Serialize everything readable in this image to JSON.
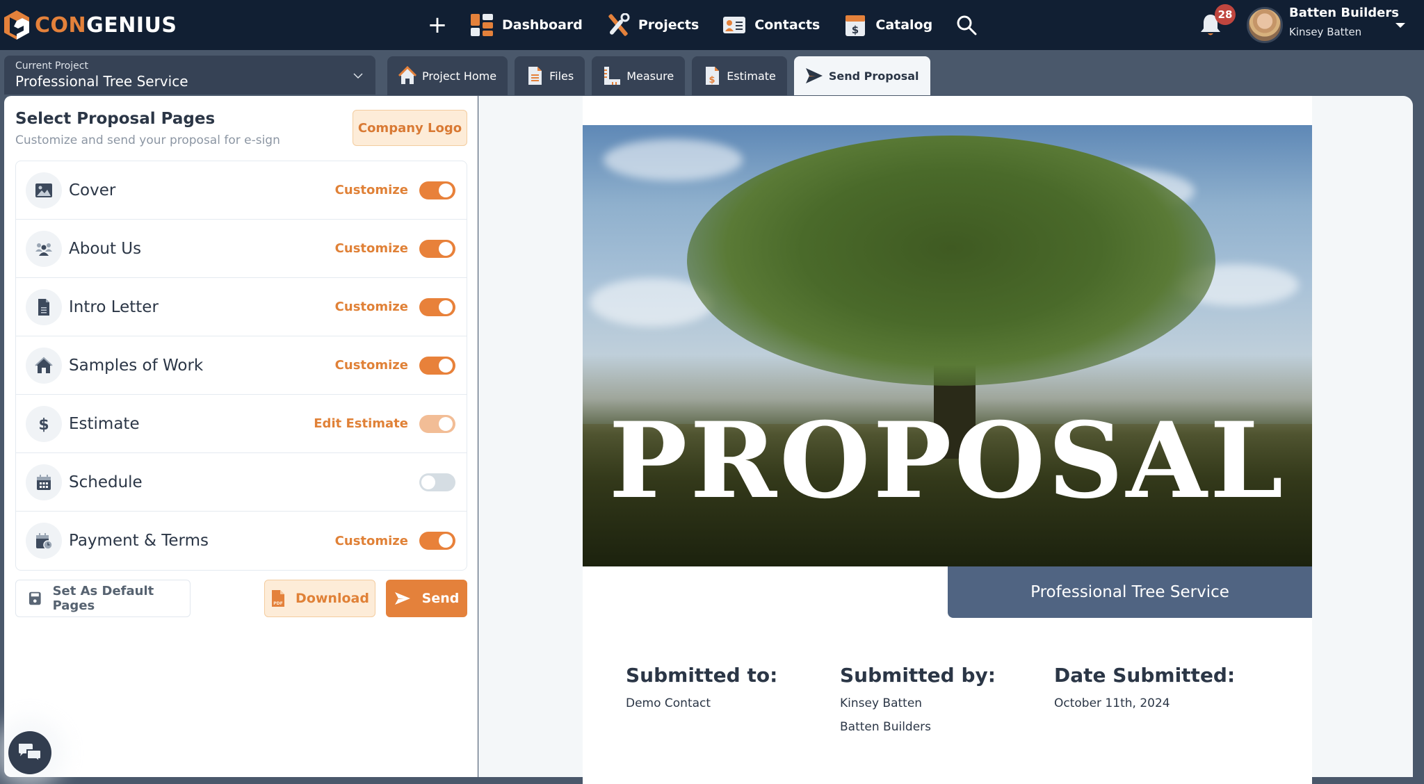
{
  "brand": {
    "name_part1": "CON",
    "name_part2": "GENIUS",
    "accent": "#e4813b",
    "dark": "#111f33"
  },
  "nav": {
    "add_icon": "plus-icon",
    "items": [
      {
        "label": "Dashboard",
        "icon": "dashboard-icon"
      },
      {
        "label": "Projects",
        "icon": "tools-icon"
      },
      {
        "label": "Contacts",
        "icon": "contact-card-icon"
      },
      {
        "label": "Catalog",
        "icon": "catalog-box-icon"
      }
    ],
    "search_icon": "search-icon"
  },
  "notifications": {
    "count": "28"
  },
  "user": {
    "company": "Batten Builders",
    "name": "Kinsey Batten"
  },
  "project": {
    "label": "Current Project",
    "value": "Professional Tree Service"
  },
  "tabs": [
    {
      "label": "Project Home",
      "icon": "home-icon",
      "active": false
    },
    {
      "label": "Files",
      "icon": "file-icon",
      "active": false
    },
    {
      "label": "Measure",
      "icon": "ruler-icon",
      "active": false
    },
    {
      "label": "Estimate",
      "icon": "estimate-icon",
      "active": false
    },
    {
      "label": "Send Proposal",
      "icon": "send-icon",
      "active": true
    }
  ],
  "panel": {
    "title": "Select Proposal Pages",
    "subtitle": "Customize and send your proposal for e-sign",
    "logo_button": "Company Logo",
    "pages": [
      {
        "label": "Cover",
        "icon": "image-icon",
        "action": "Customize",
        "enabled": true
      },
      {
        "label": "About Us",
        "icon": "users-icon",
        "action": "Customize",
        "enabled": true
      },
      {
        "label": "Intro Letter",
        "icon": "document-icon",
        "action": "Customize",
        "enabled": true
      },
      {
        "label": "Samples of Work",
        "icon": "house-icon",
        "action": "Customize",
        "enabled": true
      },
      {
        "label": "Estimate",
        "icon": "dollar-icon",
        "action": "Edit Estimate",
        "enabled": true,
        "locked": true
      },
      {
        "label": "Schedule",
        "icon": "calendar-icon",
        "action": "",
        "enabled": false
      },
      {
        "label": "Payment & Terms",
        "icon": "calendar-clock-icon",
        "action": "Customize",
        "enabled": true
      }
    ],
    "default_button": "Set As Default Pages",
    "download_button": "Download",
    "send_button": "Send"
  },
  "preview": {
    "cover_title": "PROPOSAL",
    "company": "Professional Tree Service",
    "submitted_to": {
      "heading": "Submitted to:",
      "lines": [
        "Demo Contact"
      ]
    },
    "submitted_by": {
      "heading": "Submitted by:",
      "lines": [
        "Kinsey Batten",
        "Batten Builders"
      ]
    },
    "date_submitted": {
      "heading": "Date Submitted:",
      "lines": [
        "October 11th, 2024"
      ]
    }
  }
}
